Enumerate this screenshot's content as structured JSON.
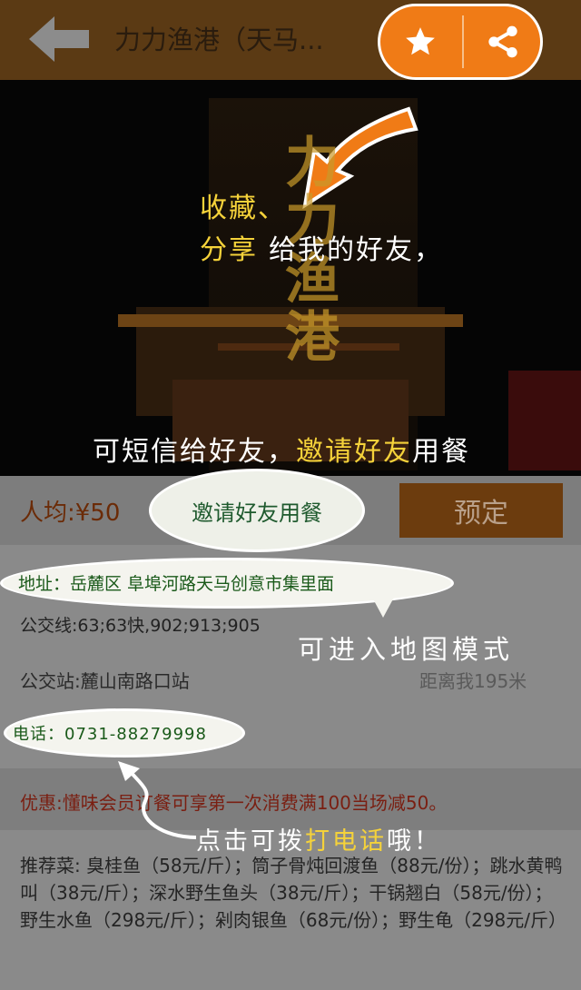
{
  "header": {
    "title": "力力渔港（天马...",
    "colors": {
      "bar": "#5b3a14",
      "action_pill": "#f07b16"
    }
  },
  "hero": {
    "tip_favorite": "收藏、",
    "tip_share_a": "分享",
    "tip_share_b": "给我的好友，",
    "tip_sms_a": "可短信给好友，",
    "tip_sms_b": "邀请好友",
    "tip_sms_c": "用餐"
  },
  "info": {
    "avg_price": "人均:¥50",
    "invite_button": "邀请好友用餐",
    "book_button": "预定",
    "address": "地址：岳麓区 阜埠河路天马创意市集里面",
    "bus_lines": "公交线:63;63快,902;913;905",
    "map_tip": "可进入地图模式",
    "bus_stop": "公交站:麓山南路口站",
    "distance": "距离我195米",
    "phone": "电话：0731-88279998",
    "promo": "优惠:懂味会员订餐可享第一次消费满100当场减50。",
    "call_tip_a": "点击可拨",
    "call_tip_b": "打电话",
    "call_tip_c": "哦！",
    "recommend": "推荐菜: 臭桂鱼（58元/斤）；筒子骨炖回渡鱼（88元/份）；跳水黄鸭叫（38元/斤）；深水野生鱼头（38元/斤）；干锅翘白（58元/份）；野生水鱼（298元/斤）；剁肉银鱼（68元/份）；野生龟（298元/斤）"
  },
  "icons": {
    "back": "back-arrow-icon",
    "favorite": "star-icon",
    "share": "share-icon"
  }
}
